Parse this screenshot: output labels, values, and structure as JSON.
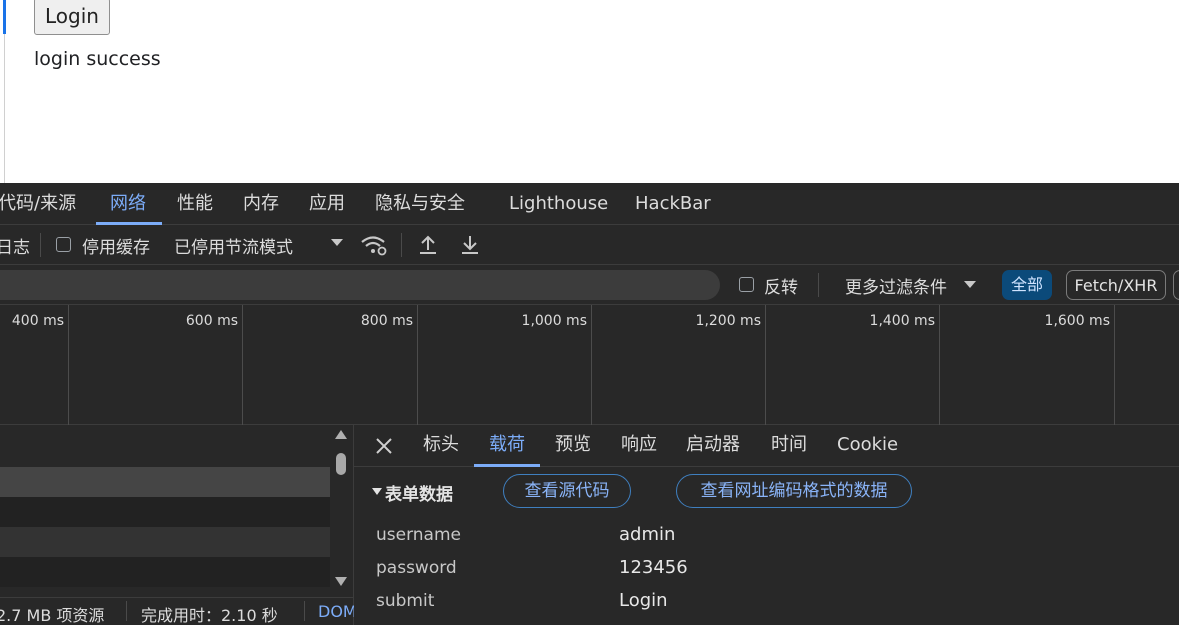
{
  "page": {
    "login_button": "Login",
    "message": "login success"
  },
  "devtools": {
    "tabs": [
      "代码/来源",
      "网络",
      "性能",
      "内存",
      "应用",
      "隐私与安全",
      "Lighthouse",
      "HackBar"
    ],
    "toolbar": {
      "preserve_log_fragment": "日志",
      "disable_cache": "停用缓存",
      "throttling": "已停用节流模式"
    },
    "filter": {
      "invert": "反转",
      "more_filters": "更多过滤条件",
      "all": "全部",
      "fetch_xhr": "Fetch/XHR"
    },
    "timeline_ticks": [
      "400 ms",
      "600 ms",
      "800 ms",
      "1,000 ms",
      "1,200 ms",
      "1,400 ms",
      "1,600 ms"
    ],
    "status": {
      "resources": "2.7 MB 项资源",
      "finish": "完成用时：2.10 秒",
      "dom": "DOM"
    },
    "detail": {
      "tabs": [
        "标头",
        "载荷",
        "预览",
        "响应",
        "启动器",
        "时间",
        "Cookie"
      ],
      "section_title": "表单数据",
      "view_source": "查看源代码",
      "view_url_encoded": "查看网址编码格式的数据",
      "form": [
        {
          "key": "username",
          "value": "admin"
        },
        {
          "key": "password",
          "value": "123456"
        },
        {
          "key": "submit",
          "value": "Login"
        }
      ]
    }
  },
  "colors": {
    "accent": "#7cacf8",
    "panel_bg": "#282828",
    "chip_active_bg": "#0b4a7a"
  }
}
